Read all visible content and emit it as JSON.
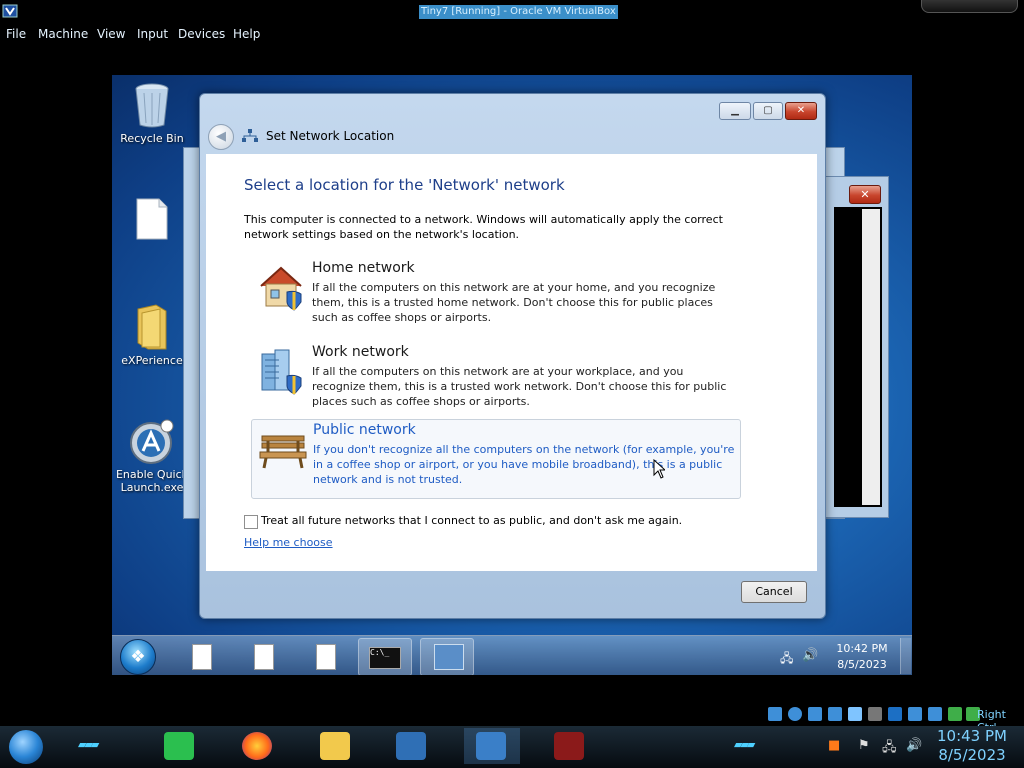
{
  "host": {
    "window_title": "Tiny7 [Running] - Oracle VM VirtualBox",
    "menu": [
      "File",
      "Machine",
      "View",
      "Input",
      "Devices",
      "Help"
    ],
    "status_host_key": "Right Ctrl",
    "clock_time": "10:43 PM",
    "clock_date": "8/5/2023"
  },
  "desktop": {
    "icons": [
      {
        "label": "Recycle Bin",
        "icon": "recycle-bin-icon"
      },
      {
        "label": "",
        "icon": "blank-document-icon"
      },
      {
        "label": "eXPerience",
        "icon": "folder-icon"
      },
      {
        "label": "Enable Quick Launch.exe",
        "icon": "quick-launch-icon"
      }
    ]
  },
  "dialog": {
    "title": "Set Network Location",
    "heading": "Select a location for the 'Network' network",
    "intro": "This computer is connected to a network. Windows will automatically apply the correct network settings based on the network's location.",
    "options": [
      {
        "title": "Home network",
        "icon": "house-icon",
        "selected": false,
        "description": "If all the computers on this network are at your home, and you recognize them, this is a trusted home network.  Don't choose this for public places such as coffee shops or airports."
      },
      {
        "title": "Work network",
        "icon": "office-building-icon",
        "selected": false,
        "description": "If all the computers on this network are at your workplace, and you recognize them, this is a trusted work network.  Don't choose this for public places such as coffee shops or airports."
      },
      {
        "title": "Public network",
        "icon": "park-bench-icon",
        "selected": true,
        "description": "If you don't recognize all the computers on the network (for example, you're in a coffee shop or airport, or you have mobile broadband), this is a public network and is not trusted."
      }
    ],
    "checkbox_label": "Treat all future networks that I connect to as public, and don't ask me again.",
    "checkbox_checked": false,
    "help_link": "Help me choose",
    "cancel_label": "Cancel"
  },
  "guest_taskbar": {
    "time": "10:42 PM",
    "date": "8/5/2023"
  },
  "colors": {
    "accent_link": "#1f5cc4",
    "heading_blue": "#1e3f8a",
    "close_red": "#c8452d"
  }
}
